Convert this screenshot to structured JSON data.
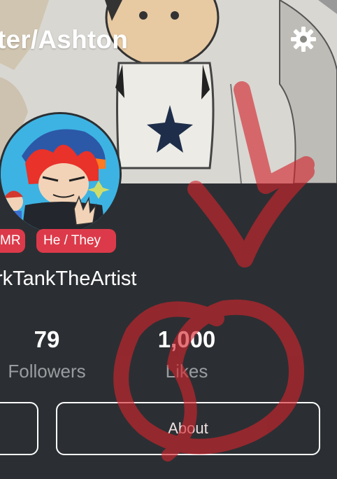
{
  "header": {
    "title": "ter/Ashton",
    "settings_icon": "gear-icon"
  },
  "profile": {
    "badges": [
      "MR",
      "He / They"
    ],
    "username": "rkTankTheArtist",
    "stats": [
      {
        "value": "79",
        "label": "Followers"
      },
      {
        "value": "1,000",
        "label": "Likes"
      }
    ]
  },
  "buttons": {
    "about_label": "About"
  },
  "colors": {
    "panel_bg": "#2b2f33",
    "badge_red": "#dc3a4a",
    "label_gray": "#9a9da0",
    "avatar_ring": "#3db3e3"
  }
}
